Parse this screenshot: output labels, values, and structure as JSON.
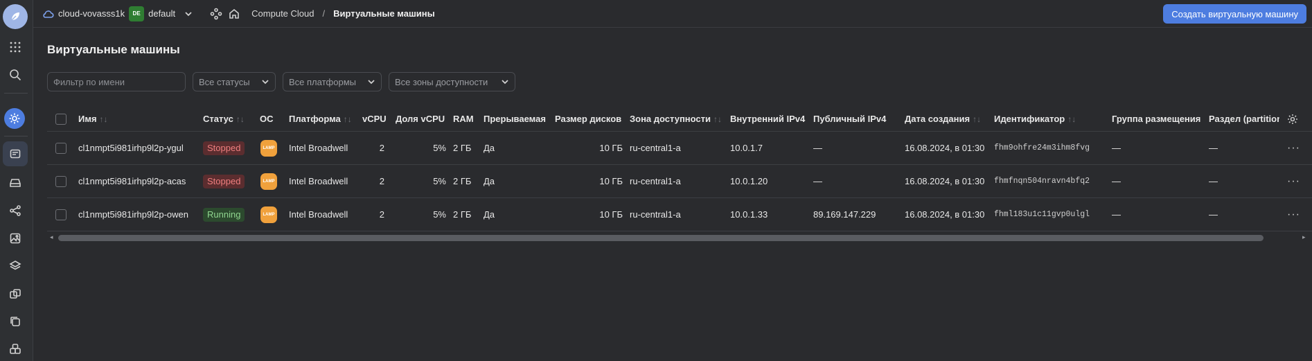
{
  "rail": {
    "icons": [
      "logo-icon",
      "apps-grid-icon",
      "search-icon",
      "settings-icon",
      "compute-icon",
      "disk-icon",
      "network-icon",
      "image-icon",
      "layers-icon",
      "snapshot-icon",
      "copy-icon",
      "group-icon"
    ]
  },
  "topbar": {
    "cloud_name": "cloud-vovasss1k",
    "folder_badge": "DE",
    "folder_name": "default",
    "breadcrumb_service": "Compute Cloud",
    "breadcrumb_sep": "/",
    "breadcrumb_current": "Виртуальные машины",
    "create_button": "Создать виртуальную машину"
  },
  "main": {
    "title": "Виртуальные машины",
    "filters": {
      "name_placeholder": "Фильтр по имени",
      "status": "Все статусы",
      "platform": "Все платформы",
      "zone": "Все зоны доступности"
    }
  },
  "colors": {
    "accent": "#4d7de0",
    "stopped": "#ef7e7e",
    "running": "#8fd58f",
    "os_badge": "#f0a13c"
  },
  "table": {
    "headers": {
      "name": "Имя",
      "status": "Статус",
      "os": "ОС",
      "platform": "Платформа",
      "vcpu": "vCPU",
      "vcpu_share": "Доля vCPU",
      "ram": "RAM",
      "preemptible": "Прерываемая",
      "disk_size": "Размер дисков",
      "zone": "Зона доступности",
      "ipv4_internal": "Внутренний IPv4",
      "ipv4_public": "Публичный IPv4",
      "created": "Дата создания",
      "id": "Идентификатор",
      "placement_group": "Группа размещения",
      "partition": "Раздел (partition"
    },
    "rows": [
      {
        "name": "cl1nmpt5i981irhp9l2p-ygul",
        "status": "Stopped",
        "os": "LAMP",
        "platform": "Intel Broadwell",
        "vcpu": "2",
        "vcpu_share": "5%",
        "ram": "2 ГБ",
        "preemptible": "Да",
        "disk_size": "10 ГБ",
        "zone": "ru-central1-a",
        "ipv4_internal": "10.0.1.7",
        "ipv4_public": "—",
        "created": "16.08.2024, в 01:30",
        "id": "fhm9ohfre24m3ihm8fvg",
        "placement_group": "—",
        "partition": "—",
        "menu": "···"
      },
      {
        "name": "cl1nmpt5i981irhp9l2p-acas",
        "status": "Stopped",
        "os": "LAMP",
        "platform": "Intel Broadwell",
        "vcpu": "2",
        "vcpu_share": "5%",
        "ram": "2 ГБ",
        "preemptible": "Да",
        "disk_size": "10 ГБ",
        "zone": "ru-central1-a",
        "ipv4_internal": "10.0.1.20",
        "ipv4_public": "—",
        "created": "16.08.2024, в 01:30",
        "id": "fhmfnqn504nravn4bfq2",
        "placement_group": "—",
        "partition": "—",
        "menu": "···"
      },
      {
        "name": "cl1nmpt5i981irhp9l2p-owen",
        "status": "Running",
        "os": "LAMP",
        "platform": "Intel Broadwell",
        "vcpu": "2",
        "vcpu_share": "5%",
        "ram": "2 ГБ",
        "preemptible": "Да",
        "disk_size": "10 ГБ",
        "zone": "ru-central1-a",
        "ipv4_internal": "10.0.1.33",
        "ipv4_public": "89.169.147.229",
        "created": "16.08.2024, в 01:30",
        "id": "fhml183u1c11gvp0ulgl",
        "placement_group": "—",
        "partition": "—",
        "menu": "···"
      }
    ]
  },
  "scrollbar": {
    "left_arrow": "◂",
    "right_arrow": "▸"
  }
}
